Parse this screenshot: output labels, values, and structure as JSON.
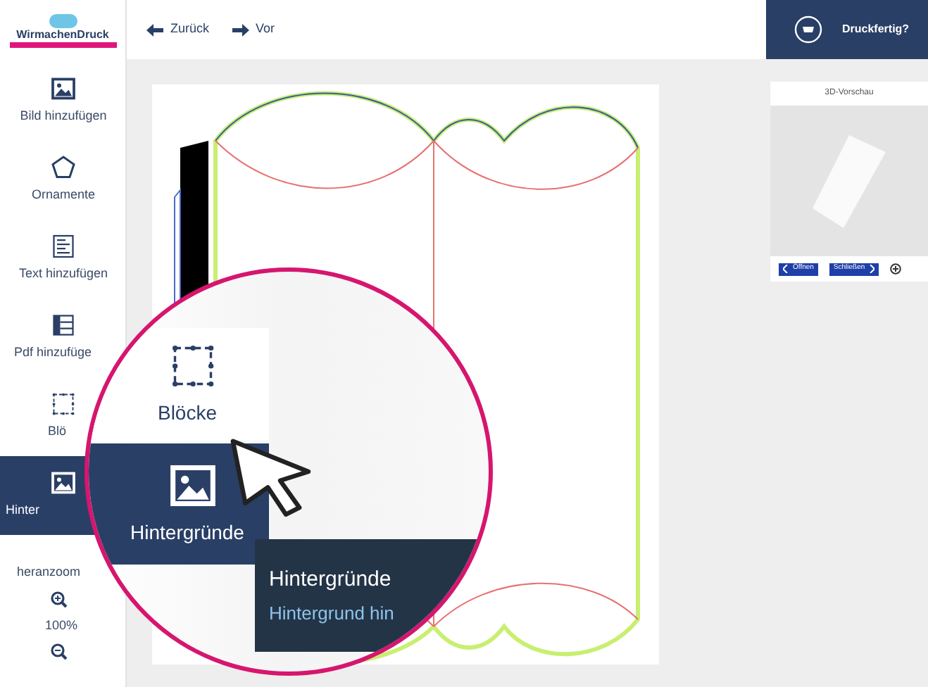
{
  "logo": {
    "name": "WirmachenDruck"
  },
  "toolbar": [
    {
      "label": "Zurück",
      "kind": "back"
    },
    {
      "label": "Vor",
      "kind": "forward"
    }
  ],
  "sidebar": {
    "items": [
      {
        "label": "Bild hinzufügen",
        "selected": false
      },
      {
        "label": "Ornamente",
        "selected": false
      },
      {
        "label": "Text hinzufügen",
        "selected": false
      },
      {
        "label": "Pdf hinzufüge",
        "selected": false
      },
      {
        "label": "Blö",
        "selected": false
      },
      {
        "label": "Hinter",
        "selected": true
      }
    ],
    "zoom": {
      "label": "heranzoom",
      "value": "100%"
    }
  },
  "checkout": {
    "label": "Druckfertig?"
  },
  "preview": {
    "title": "3D-Vorschau",
    "buttons": [
      {
        "label": "Öffnen",
        "kind": "prev"
      },
      {
        "label": "Schließen",
        "kind": "next"
      }
    ]
  },
  "magnifier": {
    "items": [
      {
        "label": "Blöcke",
        "selected": false
      },
      {
        "label": "Hintergründe",
        "selected": true
      }
    ],
    "tooltip": {
      "title": "Hintergründe",
      "text": "Hintergrund hin"
    }
  }
}
